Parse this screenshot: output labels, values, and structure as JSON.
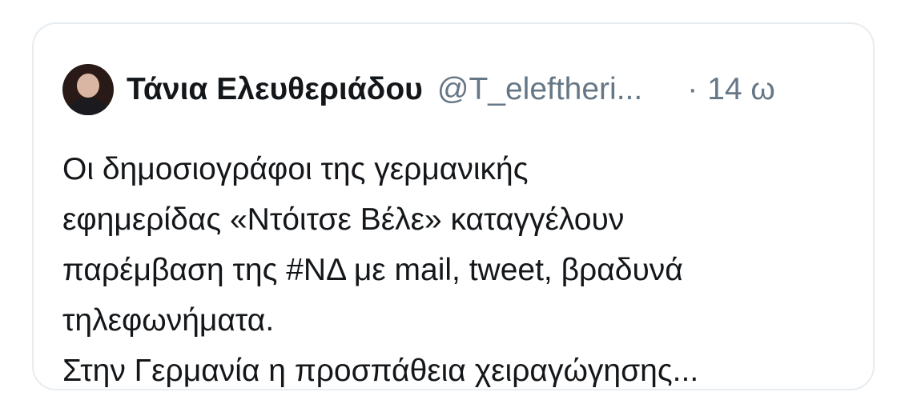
{
  "tweet": {
    "author_name": "Τάνια Ελευθεριάδου",
    "handle": "@T_eleftheri...",
    "separator": "·",
    "time": "14 ω",
    "text_lines": [
      "Οι δημοσιογράφοι της γερμανικής",
      "εφημερίδας «Ντόιτσε Βέλε» καταγγέλουν",
      "παρέμβαση της #ΝΔ με mail, tweet, βραδυνά",
      "τηλεφωνήματα.",
      "Στην Γερμανία η προσπάθεια χειραγώγησης..."
    ]
  },
  "colors": {
    "text": "#14171a",
    "muted": "#657786",
    "border": "#e6ecf0",
    "background": "#ffffff"
  }
}
